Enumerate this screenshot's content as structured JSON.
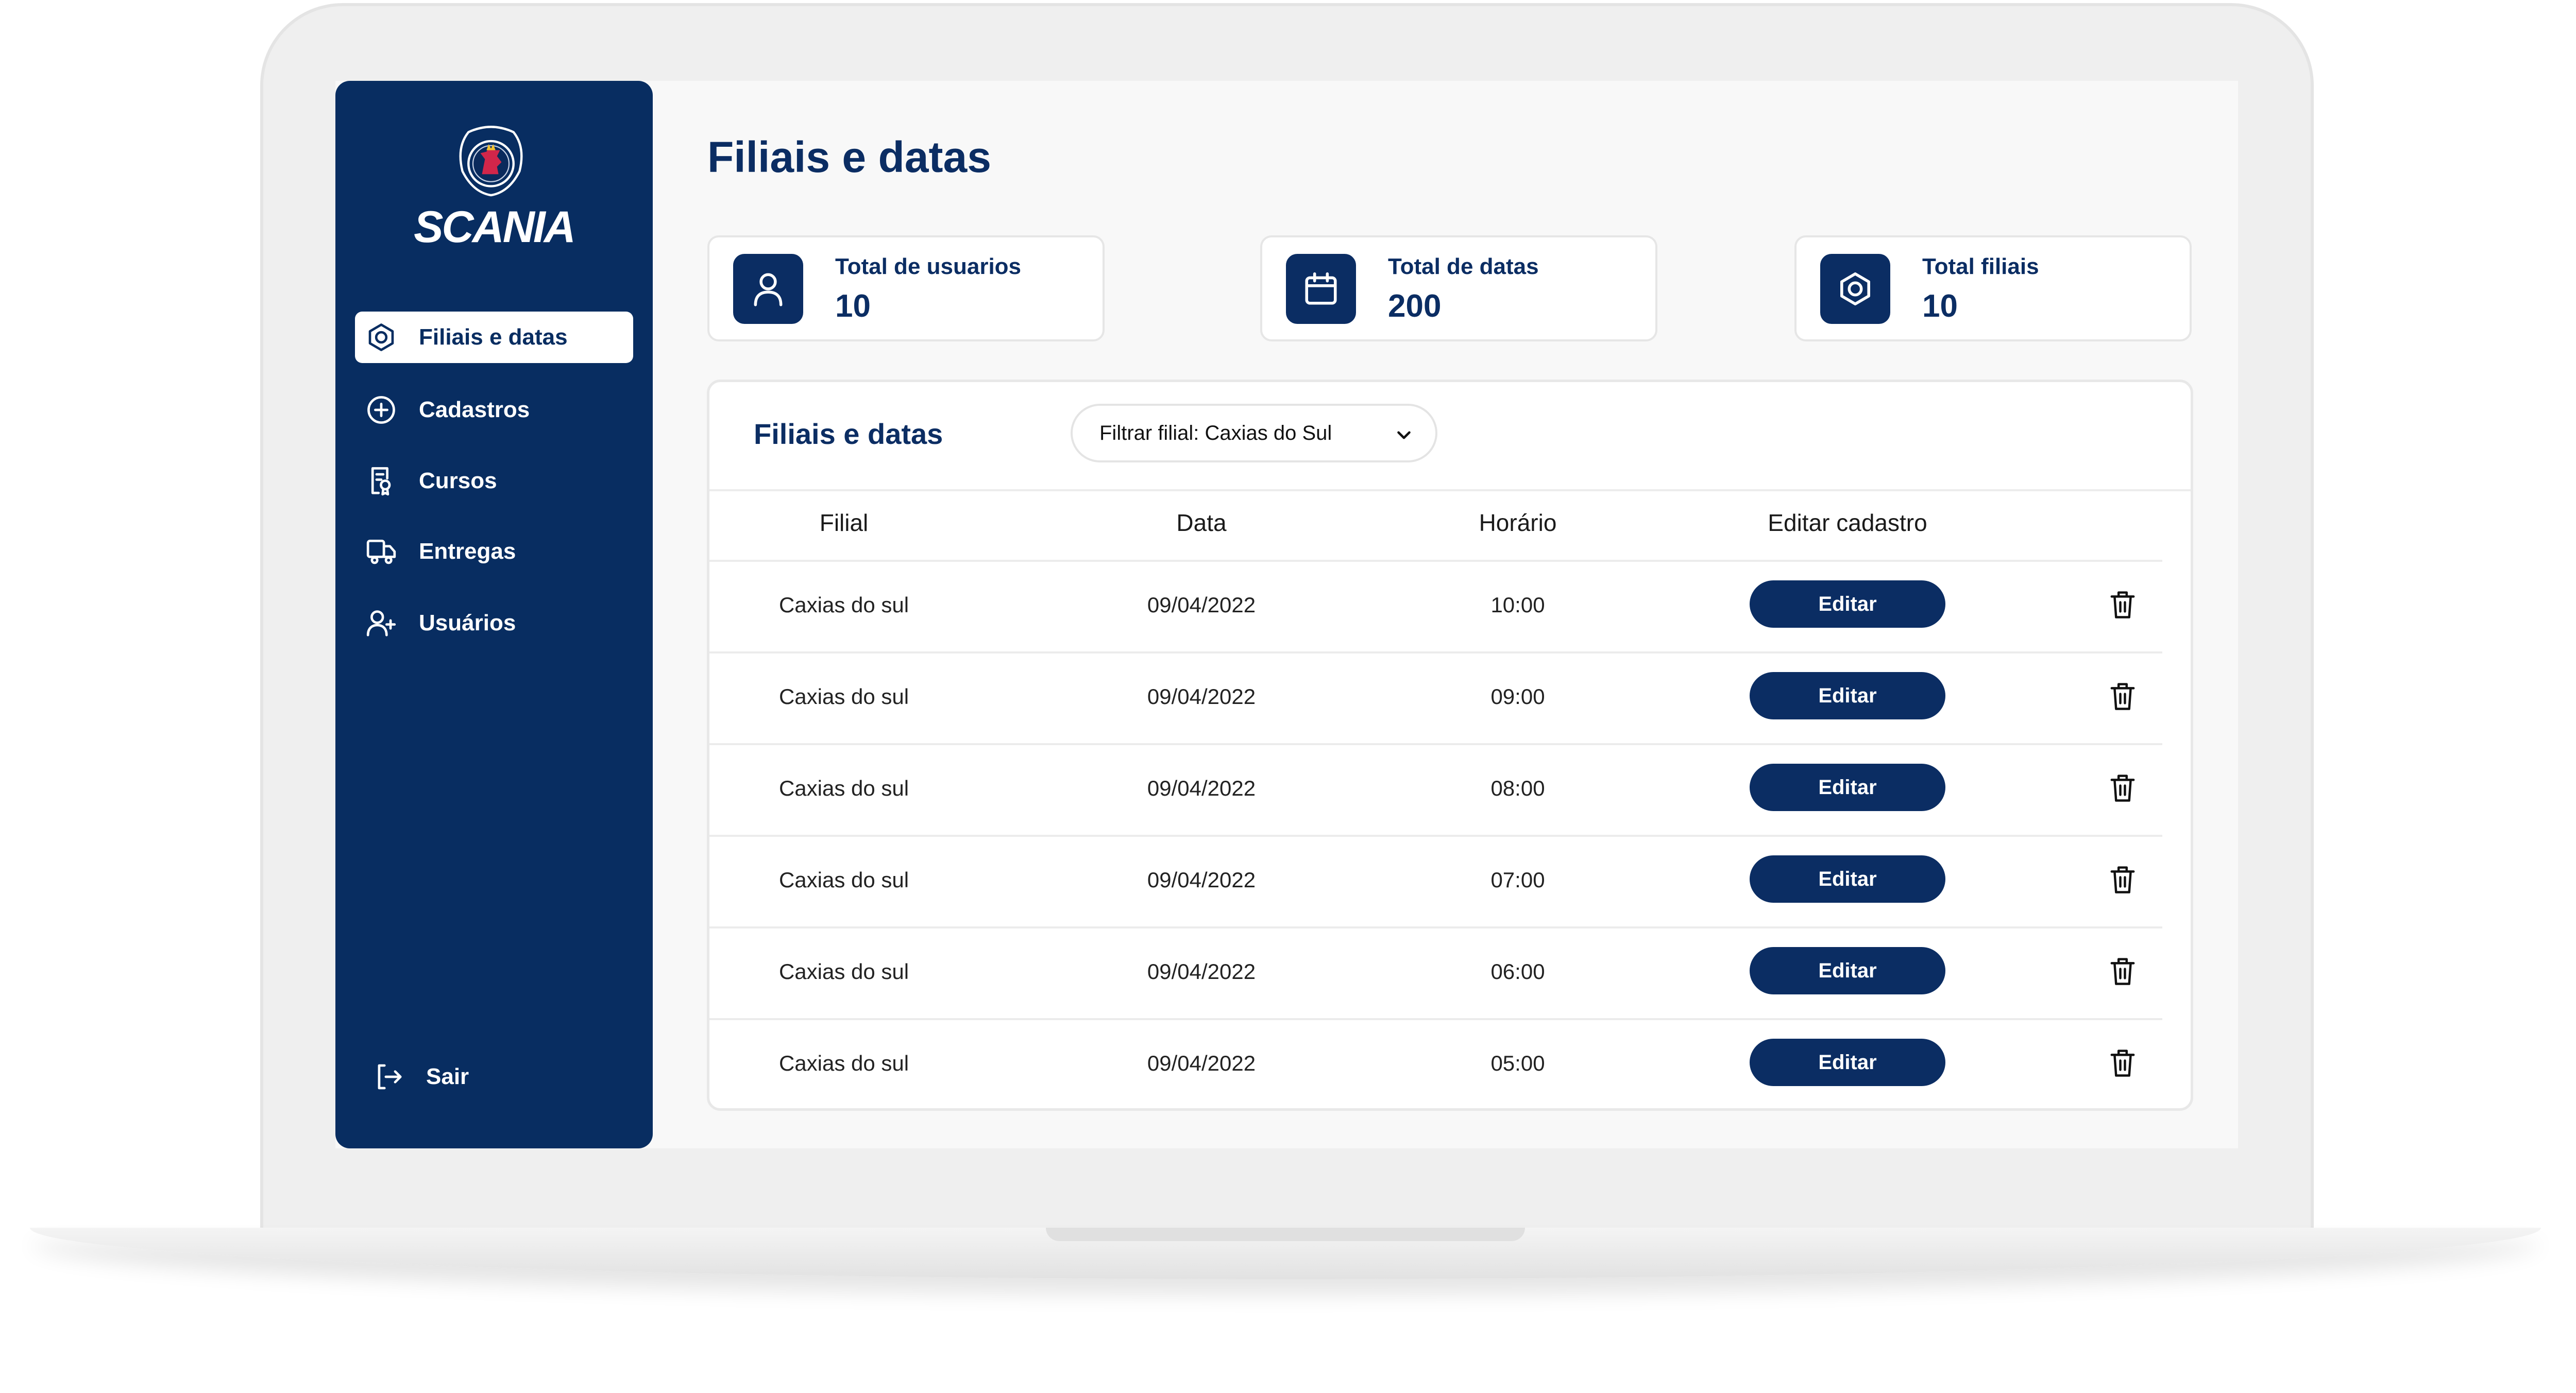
{
  "brand": {
    "name": "SCANIA"
  },
  "sidebar": {
    "items": [
      {
        "label": "Filiais e datas",
        "icon": "store-icon",
        "active": true
      },
      {
        "label": "Cadastros",
        "icon": "plus-circle-icon",
        "active": false
      },
      {
        "label": "Cursos",
        "icon": "certificate-icon",
        "active": false
      },
      {
        "label": "Entregas",
        "icon": "truck-icon",
        "active": false
      },
      {
        "label": "Usuários",
        "icon": "add-user-icon",
        "active": false
      }
    ],
    "logout": {
      "label": "Sair",
      "icon": "logout-icon"
    }
  },
  "page": {
    "title": "Filiais e datas"
  },
  "stats": [
    {
      "label": "Total de usuarios",
      "value": "10",
      "icon": "user-icon"
    },
    {
      "label": "Total de datas",
      "value": "200",
      "icon": "calendar-icon"
    },
    {
      "label": "Total filiais",
      "value": "10",
      "icon": "store-icon"
    }
  ],
  "table": {
    "title": "Filiais e datas",
    "filter": {
      "label": "Filtrar filial: Caxias do Sul",
      "icon": "chevron-down-icon"
    },
    "columns": [
      "Filial",
      "Data",
      "Horário",
      "Editar cadastro"
    ],
    "edit_label": "Editar",
    "rows": [
      {
        "filial": "Caxias do sul",
        "data": "09/04/2022",
        "horario": "10:00"
      },
      {
        "filial": "Caxias do sul",
        "data": "09/04/2022",
        "horario": "09:00"
      },
      {
        "filial": "Caxias do sul",
        "data": "09/04/2022",
        "horario": "08:00"
      },
      {
        "filial": "Caxias do sul",
        "data": "09/04/2022",
        "horario": "07:00"
      },
      {
        "filial": "Caxias do sul",
        "data": "09/04/2022",
        "horario": "06:00"
      },
      {
        "filial": "Caxias do sul",
        "data": "09/04/2022",
        "horario": "05:00"
      }
    ]
  },
  "colors": {
    "primary": "#0b2d63",
    "sidebar": "#082d61",
    "background": "#f8f8f8"
  }
}
